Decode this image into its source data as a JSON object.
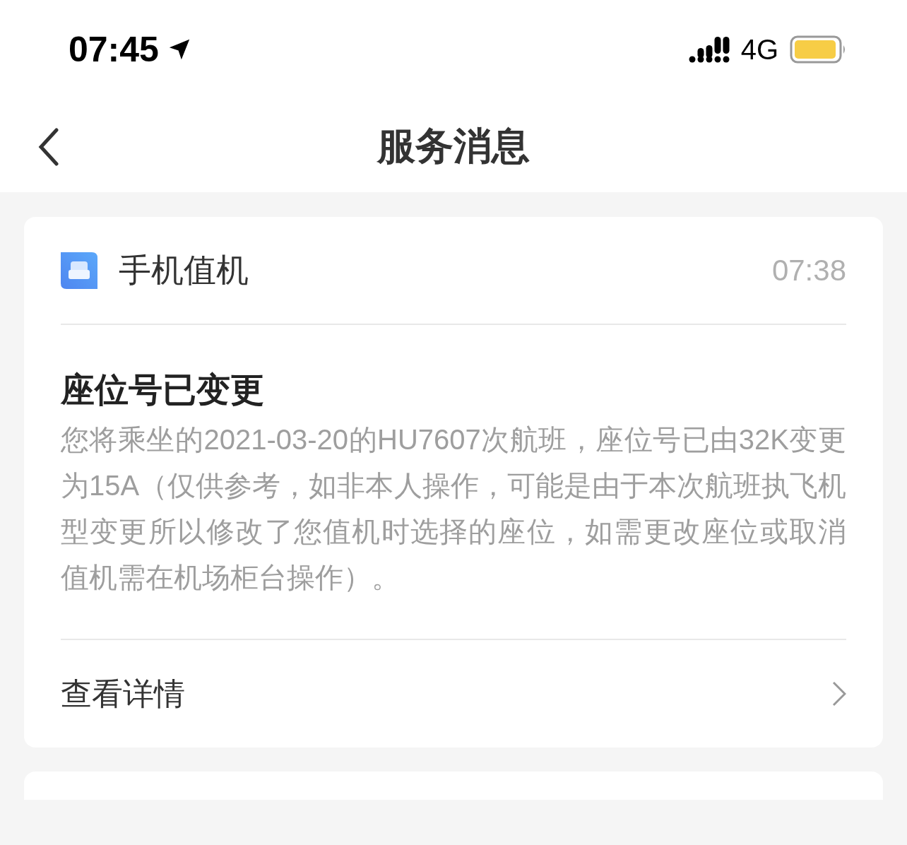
{
  "status_bar": {
    "time": "07:45",
    "network": "4G"
  },
  "nav_bar": {
    "title": "服务消息"
  },
  "messages": [
    {
      "app_name": "手机值机",
      "time": "07:38",
      "title": "座位号已变更",
      "body": "您将乘坐的2021-03-20的HU7607次航班，座位号已由32K变更为15A（仅供参考，如非本人操作，可能是由于本次航班执飞机型变更所以修改了您值机时选择的座位，如需更改座位或取消值机需在机场柜台操作）。",
      "action": "查看详情"
    }
  ]
}
